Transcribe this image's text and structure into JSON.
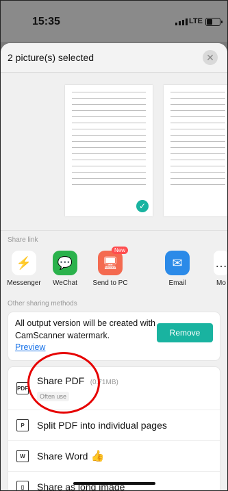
{
  "status": {
    "time": "15:35",
    "network": "LTE"
  },
  "sheet": {
    "title": "2 picture(s) selected"
  },
  "share_link": {
    "label": "Share link",
    "items": [
      {
        "label": "Messenger",
        "color": "#1a7cf2"
      },
      {
        "label": "WeChat",
        "color": "#2bb24c"
      },
      {
        "label": "Send to PC",
        "color": "#f46a50",
        "badge": "New"
      },
      {
        "label": "Email",
        "color": "#2b8ae8"
      },
      {
        "label": "Mo"
      }
    ]
  },
  "other_methods": {
    "label": "Other sharing methods"
  },
  "watermark_notice": {
    "text": "All output version will be created with CamScanner watermark.",
    "preview_link": "Preview",
    "remove_button": "Remove"
  },
  "options": [
    {
      "label": "Share PDF",
      "size": "(0.71MB)",
      "tag": "Often use",
      "icon": "pdf-icon"
    },
    {
      "label": "Split PDF into individual pages",
      "icon": "split-pdf-icon"
    },
    {
      "label": "Share Word",
      "emoji": "👍",
      "icon": "word-icon"
    },
    {
      "label": "Share as long image",
      "icon": "long-image-icon"
    }
  ]
}
